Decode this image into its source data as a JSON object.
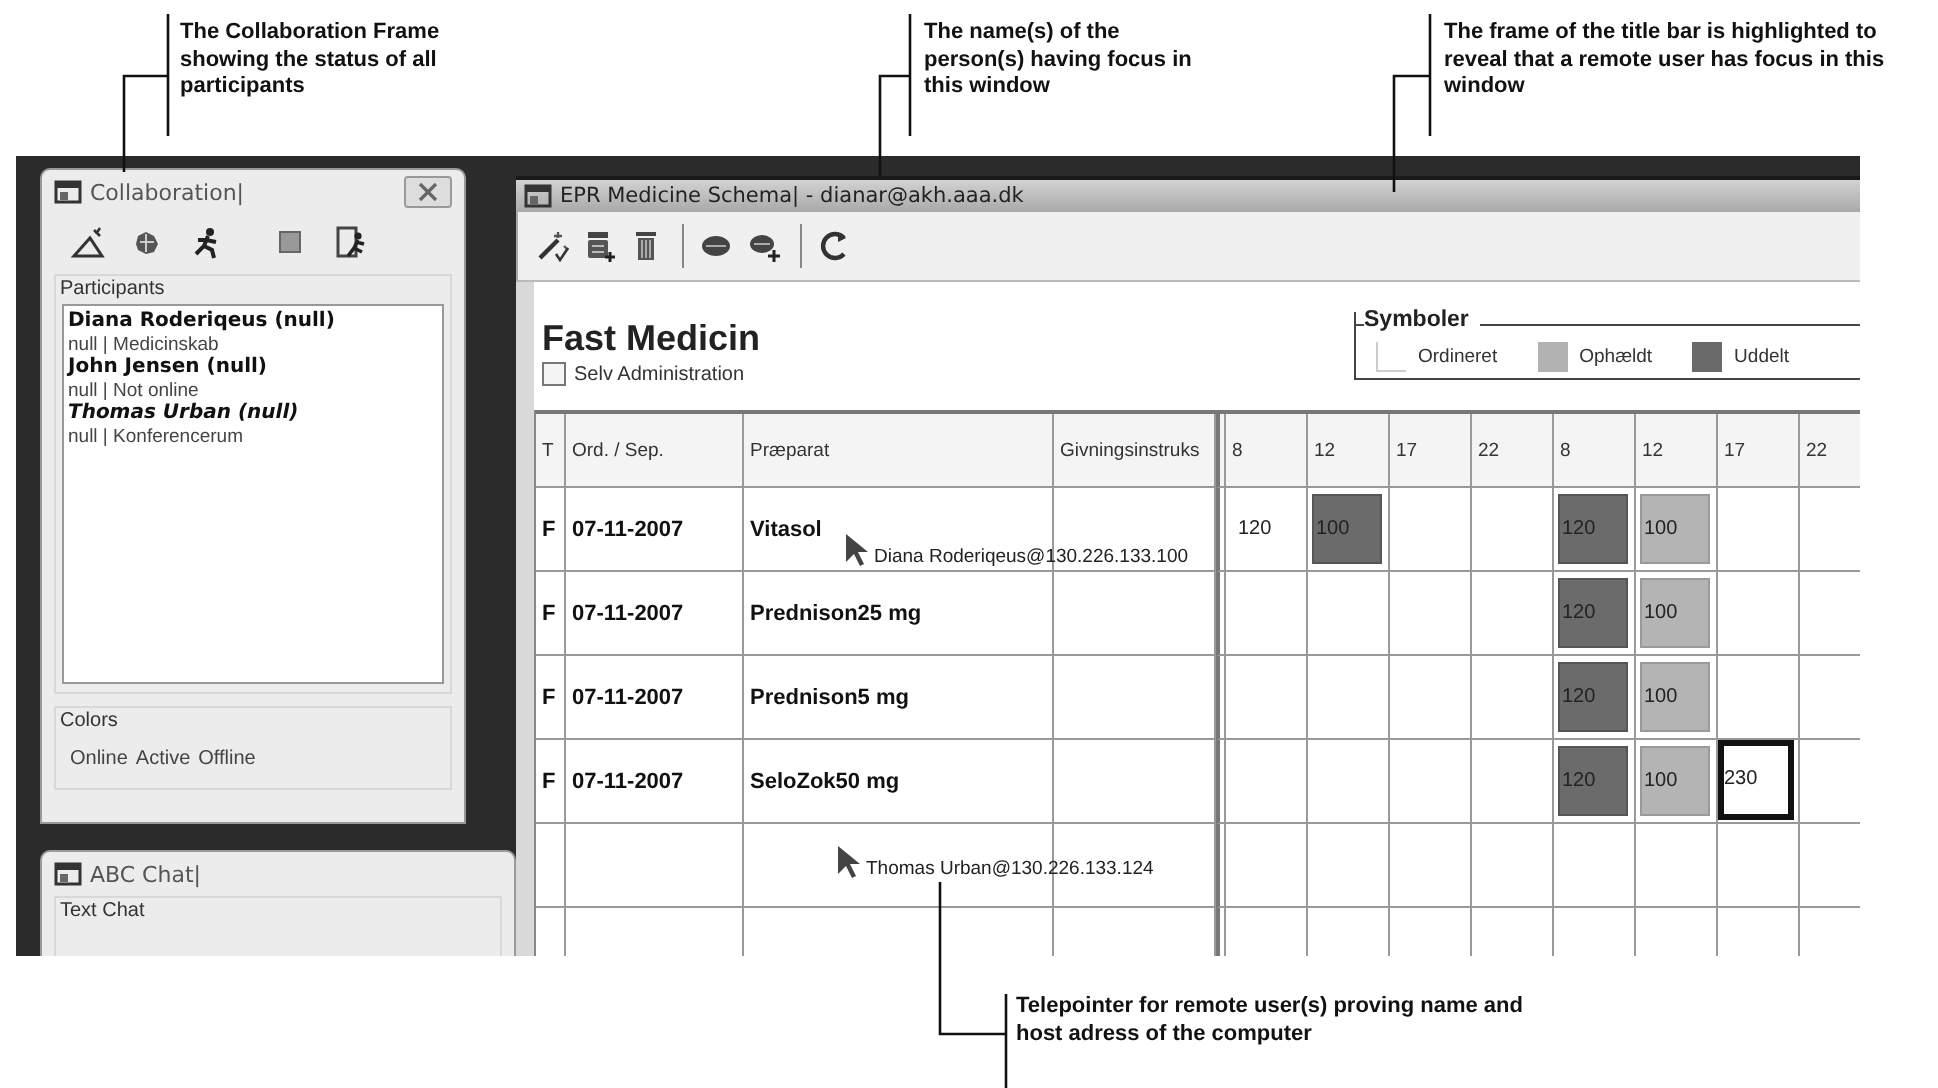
{
  "callouts": [
    {
      "text": "The Collaboration Frame showing the status of all participants"
    },
    {
      "text": "The name(s) of the person(s) having focus in this window"
    },
    {
      "text": "The frame of the title bar is highlighted to reveal that a remote user has focus in this window"
    },
    {
      "text": "Telepointer for remote user(s) proving name and host adress of the computer"
    }
  ],
  "collaboration": {
    "title": "Collaboration|",
    "participants_label": "Participants",
    "participants": [
      {
        "name": "Diana Roderiqeus (null)",
        "detail": "null | Medicinskab",
        "highlighted": false
      },
      {
        "name": "John Jensen (null)",
        "detail": "null | Not online",
        "highlighted": false
      },
      {
        "name": "Thomas Urban (null)",
        "detail": "null | Konferencerum",
        "highlighted": true
      }
    ],
    "colors_label": "Colors",
    "colors": [
      "Online",
      "Active",
      "Offline"
    ]
  },
  "chat": {
    "title": "ABC Chat|",
    "group_label": "Text Chat"
  },
  "main_window": {
    "title": "EPR Medicine Schema| - dianar@akh.aaa.dk",
    "title_highlighted": true,
    "heading": "Fast Medicin",
    "self_admin": {
      "label": "Selv Administration",
      "checked": false
    },
    "legend": {
      "title": "Symboler",
      "items": [
        {
          "label": "Ordineret",
          "kind": "ordineret"
        },
        {
          "label": "Ophældt",
          "kind": "ophaeldt"
        },
        {
          "label": "Uddelt",
          "kind": "uddelt"
        }
      ]
    },
    "table": {
      "columns": [
        "T",
        "Ord. / Sep.",
        "Præparat",
        "Givningsinstruks",
        "8",
        "12",
        "17",
        "22",
        "8",
        "12",
        "17",
        "22"
      ],
      "rows": [
        {
          "type": "F",
          "date": "07-11-2007",
          "drug": "Vitasol",
          "telepointer": "Diana Roderiqeus@130.226.133.100",
          "doses": [
            {
              "value": "120",
              "kind": "ordineret",
              "selected": false
            },
            {
              "value": "100",
              "kind": "uddelt",
              "selected": false
            },
            {
              "kind": "empty",
              "selected": false
            },
            {
              "kind": "empty",
              "selected": false
            },
            {
              "value": "120",
              "kind": "uddelt",
              "selected": false
            },
            {
              "value": "100",
              "kind": "ophaeldt",
              "selected": false
            },
            {
              "kind": "empty",
              "selected": false
            },
            {
              "kind": "empty",
              "selected": false
            }
          ]
        },
        {
          "type": "F",
          "date": "07-11-2007",
          "drug": "Prednison25 mg",
          "doses": [
            {
              "kind": "empty",
              "selected": false
            },
            {
              "kind": "empty",
              "selected": false
            },
            {
              "kind": "empty",
              "selected": false
            },
            {
              "kind": "empty",
              "selected": false
            },
            {
              "value": "120",
              "kind": "uddelt",
              "selected": false
            },
            {
              "value": "100",
              "kind": "ophaeldt",
              "selected": false
            },
            {
              "kind": "empty",
              "selected": false
            },
            {
              "kind": "empty",
              "selected": false
            }
          ]
        },
        {
          "type": "F",
          "date": "07-11-2007",
          "drug": "Prednison5 mg",
          "doses": [
            {
              "kind": "empty",
              "selected": false
            },
            {
              "kind": "empty",
              "selected": false
            },
            {
              "kind": "empty",
              "selected": false
            },
            {
              "kind": "empty",
              "selected": false
            },
            {
              "value": "120",
              "kind": "uddelt",
              "selected": false
            },
            {
              "value": "100",
              "kind": "ophaeldt",
              "selected": false
            },
            {
              "kind": "empty",
              "selected": false
            },
            {
              "kind": "empty",
              "selected": false
            }
          ]
        },
        {
          "type": "F",
          "date": "07-11-2007",
          "drug": "SeloZok50 mg",
          "doses": [
            {
              "kind": "empty",
              "selected": false
            },
            {
              "kind": "empty",
              "selected": false
            },
            {
              "kind": "empty",
              "selected": false
            },
            {
              "kind": "empty",
              "selected": false
            },
            {
              "value": "120",
              "kind": "uddelt",
              "selected": false
            },
            {
              "value": "100",
              "kind": "ophaeldt",
              "selected": false
            },
            {
              "value": "230",
              "kind": "ordineret",
              "selected": true
            },
            {
              "kind": "empty",
              "selected": false
            }
          ]
        },
        {
          "telepointer": "Thomas Urban@130.226.133.124"
        }
      ]
    }
  }
}
